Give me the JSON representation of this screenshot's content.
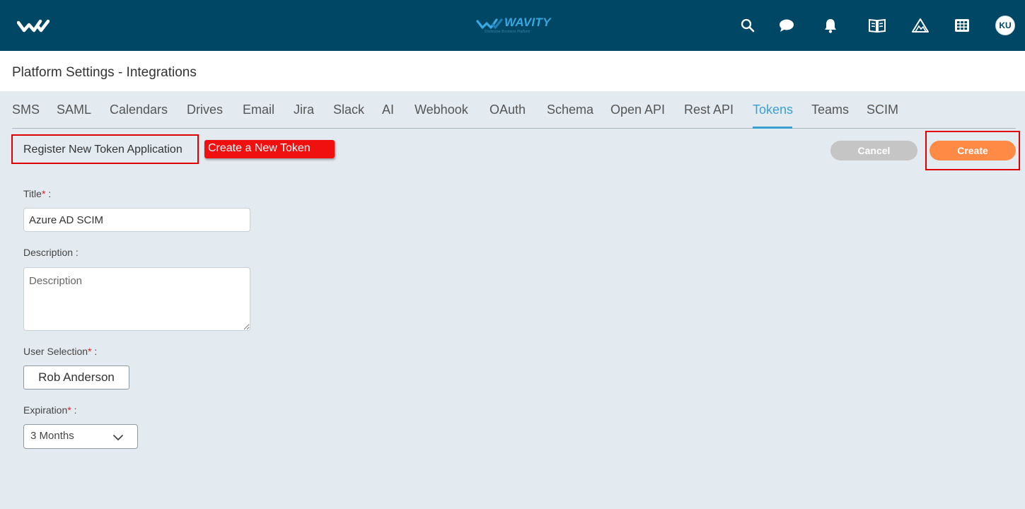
{
  "brand": {
    "name": "WAVITY",
    "tagline": "Distinctive Business Platform"
  },
  "topbar": {
    "icons": [
      "search-icon",
      "chat-icon",
      "bell-icon",
      "book-icon",
      "mountain-icon",
      "grid-icon"
    ],
    "avatar_initials": "KU"
  },
  "header": {
    "title": "Platform Settings - Integrations"
  },
  "tabs": {
    "items": [
      {
        "label": "SMS"
      },
      {
        "label": "SAML"
      },
      {
        "label": "Calendars"
      },
      {
        "label": "Drives"
      },
      {
        "label": "Email"
      },
      {
        "label": "Jira"
      },
      {
        "label": "Slack"
      },
      {
        "label": "AI"
      },
      {
        "label": "Webhook"
      },
      {
        "label": "OAuth"
      },
      {
        "label": "Schema"
      },
      {
        "label": "Open API"
      },
      {
        "label": "Rest API"
      },
      {
        "label": "Tokens"
      },
      {
        "label": "Teams"
      },
      {
        "label": "SCIM"
      }
    ],
    "active": "Tokens"
  },
  "section": {
    "title": "Register New Token Application",
    "callout": "Create a New Token"
  },
  "actions": {
    "cancel_label": "Cancel",
    "create_label": "Create"
  },
  "form": {
    "title_label": "Title",
    "title_value": "Azure AD SCIM",
    "description_label": "Description",
    "description_placeholder": "Description",
    "user_label": "User Selection",
    "user_value": "Rob Anderson",
    "expiration_label": "Expiration",
    "expiration_value": "3 Months",
    "required_mark": "*",
    "separator": ":"
  },
  "colors": {
    "topbar": "#004766",
    "accent": "#3aa0cf",
    "create": "#ff8a45",
    "cancel": "#c5c5c5",
    "highlight": "#e00000"
  }
}
